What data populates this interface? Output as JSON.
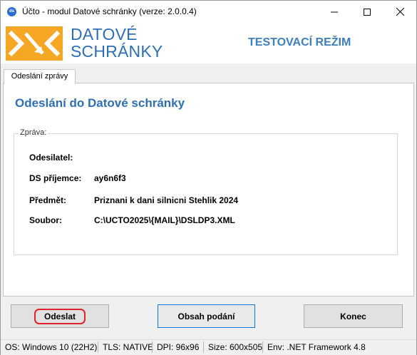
{
  "window": {
    "title": "Účto - modul Datové schránky (verze: 2.0.0.4)",
    "app_icon_text": "ds"
  },
  "banner": {
    "logo_line1": "DATOVÉ",
    "logo_line2": "SCHRÁNKY",
    "mode": "TESTOVACÍ REŽIM",
    "logo_color": "#f5a623",
    "brand_color": "#2e6fb4"
  },
  "tabs": [
    {
      "label": "Odeslání zprávy",
      "active": true
    }
  ],
  "main": {
    "heading": "Odeslání do Datové schránky",
    "group_label": "Zpráva:",
    "fields": [
      {
        "label": "Odesilatel:",
        "value": ""
      },
      {
        "label": "DS příjemce:",
        "value": "ay6n6f3"
      },
      {
        "label": "Předmět:",
        "value": "Priznani k dani silnicni Stehlik 2024"
      },
      {
        "label": "Soubor:",
        "value": "C:\\UCTO2025\\{MAIL}\\DSLDP3.XML"
      }
    ]
  },
  "buttons": {
    "send": "Odeslat",
    "content": "Obsah podání",
    "close": "Konec"
  },
  "status": {
    "os": "OS:  Windows 10 (22H2)",
    "tls": "TLS:  NATIVE",
    "dpi": "DPI:   96x96",
    "size": "Size:   600x505",
    "env": "Env:  .NET Framework 4.8"
  }
}
